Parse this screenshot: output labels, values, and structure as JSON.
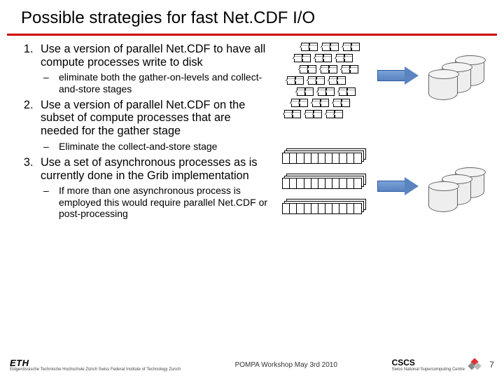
{
  "title": "Possible strategies for fast Net.CDF I/O",
  "items": [
    {
      "text": "Use a version of parallel Net.CDF to have all compute processes write to disk",
      "sub": "eliminate both the gather-on-levels and collect-and-store stages"
    },
    {
      "text": "Use a version of parallel Net.CDF on the subset of compute processes that are needed for the gather stage",
      "sub": "Eliminate the collect-and-store stage"
    },
    {
      "text": "Use a set of asynchronous processes as is currently done in the Grib implementation",
      "sub": "If more than one asynchronous process is employed this would require parallel Net.CDF or post-processing"
    }
  ],
  "footer": {
    "eth": "ETH",
    "eth_sub": "Eidgenössische Technische Hochschule Zürich\nSwiss Federal Institute of Technology Zurich",
    "center": "POMPA Workshop May 3rd 2010",
    "cscs": "CSCS",
    "cscs_sub": "Swiss National Supercomputing Centre",
    "page": "7"
  }
}
